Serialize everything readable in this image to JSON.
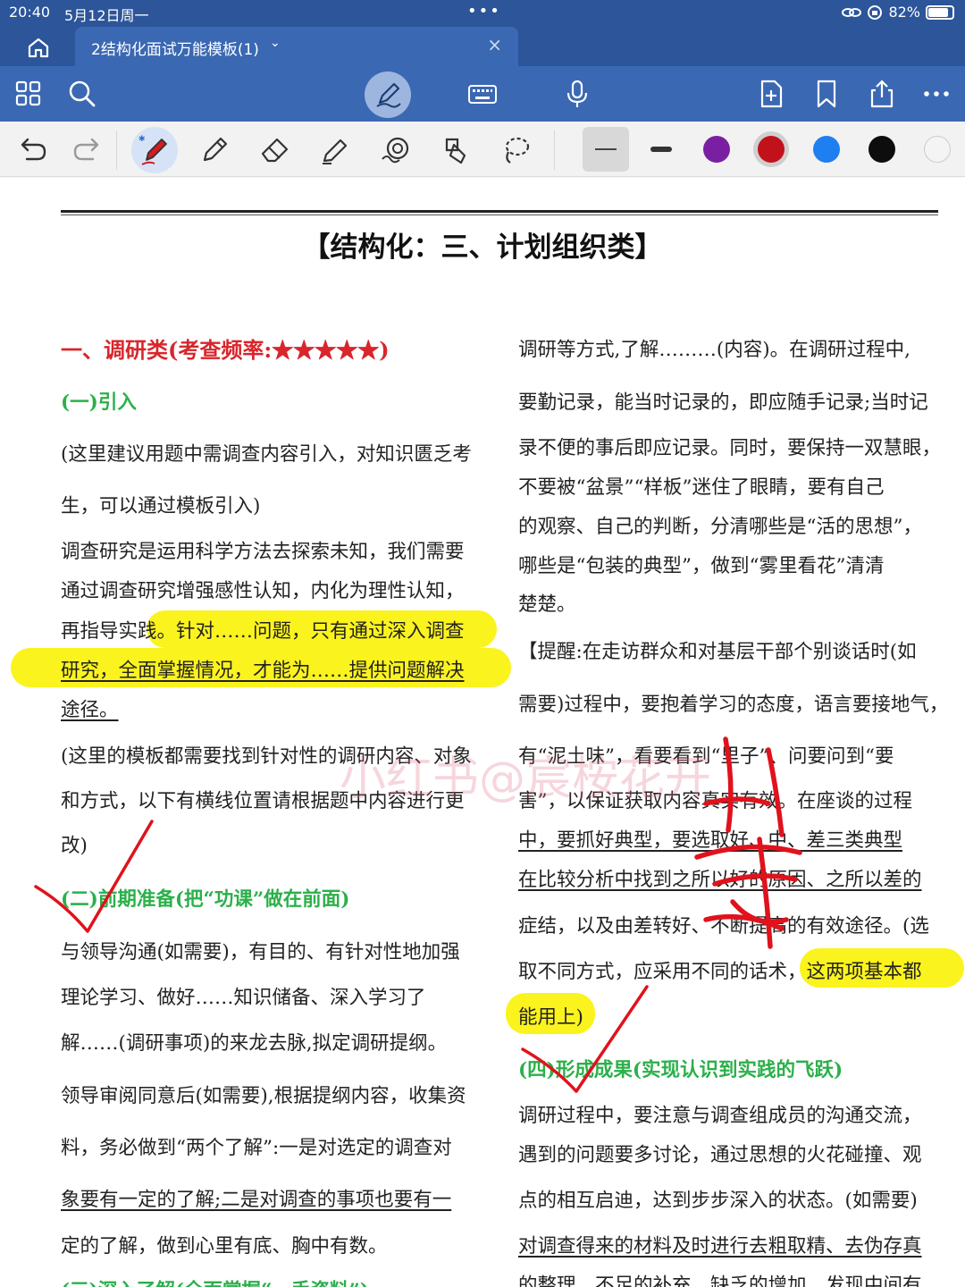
{
  "status": {
    "time": "20:40",
    "date": "5月12日周一",
    "battery": "82%"
  },
  "tab": {
    "title": "2结构化面试万能模板(1)",
    "chevron": "⌄",
    "close": "×"
  },
  "icons": {
    "main": [
      "grid-icon",
      "search-icon",
      "pen-mode-icon",
      "keyboard-icon",
      "microphone-icon",
      "add-page-icon",
      "bookmark-icon",
      "share-icon",
      "more-icon"
    ],
    "pen": [
      "undo-icon",
      "redo-icon",
      "ballpoint-pen-icon",
      "pencil-icon",
      "eraser-icon",
      "highlighter-icon",
      "shape-icon",
      "stamp-icon",
      "lasso-icon"
    ]
  },
  "colors": {
    "chrome": "#3b68b3",
    "chrome_dark": "#2c559a",
    "heading_red": "#d8262c",
    "heading_green": "#2bb04a",
    "highlight": "#fbf31d",
    "ink_red": "#e0121c",
    "swatches": [
      "#7a1fa2",
      "#c1121c",
      "#1e7ff0",
      "#0d0d0d",
      "#f4f4f4"
    ]
  },
  "doc": {
    "title": "【结构化：三、计划组织类】",
    "watermark": "小红书@宸桉花开",
    "left": [
      "一、调研类(考查频率:★★★★★)",
      "(一)引入",
      "(这里建议用题中需调查内容引入，对知识匮乏考",
      "生，可以通过模板引入)",
      "调查研究是运用科学方法去探索未知，我们需要",
      "通过调查研究增强感性认知，内化为理性认知，",
      "再指导实践。针对……问题，只有通过深入调查",
      "研究，全面掌握情况，才能为……提供问题解决",
      "途径。",
      "(这里的模板都需要找到针对性的调研内容、对象",
      "和方式，以下有横线位置请根据题中内容进行更",
      "改)",
      "(二)前期准备(把“功课”做在前面)",
      "与领导沟通(如需要)，有目的、有针对性地加强",
      "理论学习、做好……知识储备、深入学习了",
      "解……(调研事项)的来龙去脉,拟定调研提纲。",
      "领导审阅同意后(如需要),根据提纲内容，收集资",
      "料，务必做到“两个了解”:一是对选定的调查对",
      "象要有一定的了解;二是对调查的事项也要有一",
      "定的了解，做到心里有底、胸中有数。",
      "(三)深入了解(全面掌握“一手资料”)"
    ],
    "right": [
      "调研等方式,了解………(内容)。在调研过程中,",
      "要勤记录，能当时记录的，即应随手记录;当时记",
      "录不便的事后即应记录。同时，要保持一双慧眼，",
      "不要被“盆景”“样板”迷住了眼睛，要有自己",
      "的观察、自己的判断，分清哪些是“活的思想”，",
      "哪些是“包装的典型”，做到“雾里看花”清清",
      "楚楚。",
      "【提醒:在走访群众和对基层干部个别谈话时(如",
      "需要)过程中，要抱着学习的态度，语言要接地气，",
      "有“泥土味”，看要看到“里子”、问要问到“要",
      "害”，以保证获取内容真实有效。在座谈的过程",
      "中，要抓好典型，要选取好、中、差三类典型",
      "在比较分析中找到之所以好的原因、之所以差的",
      "症结，以及由差转好、不断提高的有效途径。(选",
      "取不同方式，应采用不同的话术，这两项基本都",
      "能用上)",
      "(四)形成成果(实现认识到实践的飞跃)",
      "调研过程中，要注意与调查组成员的沟通交流，",
      "遇到的问题要多讨论，通过思想的火花碰撞、观",
      "点的相互启迪，达到步步深入的状态。(如需要)",
      "对调查得来的材料及时进行去粗取精、去伪存真",
      "的整理，不足的补充，缺乏的增加，发现中间有"
    ]
  }
}
